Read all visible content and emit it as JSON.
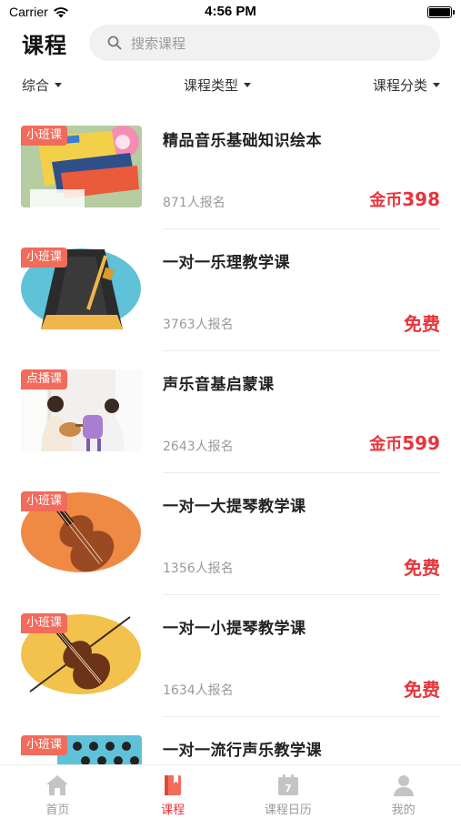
{
  "status_bar": {
    "carrier": "Carrier",
    "time": "4:56 PM"
  },
  "header": {
    "title": "课程",
    "search_placeholder": "搜索课程"
  },
  "filters": [
    {
      "label": "综合"
    },
    {
      "label": "课程类型"
    },
    {
      "label": "课程分类"
    }
  ],
  "courses": [
    {
      "tag": "小班课",
      "name": "精品音乐基础知识绘本",
      "count": "871人报名",
      "price_prefix": "金币",
      "price": "398",
      "image": "music-book-cover"
    },
    {
      "tag": "小班课",
      "name": "一对一乐理教学课",
      "count": "3763人报名",
      "price_prefix": "",
      "price": "免费",
      "image": "metronome"
    },
    {
      "tag": "点播课",
      "name": "声乐音基启蒙课",
      "count": "2643人报名",
      "price_prefix": "金币",
      "price": "599",
      "image": "ukulele-photo"
    },
    {
      "tag": "小班课",
      "name": "一对一大提琴教学课",
      "count": "1356人报名",
      "price_prefix": "",
      "price": "免费",
      "image": "cello"
    },
    {
      "tag": "小班课",
      "name": "一对一小提琴教学课",
      "count": "1634人报名",
      "price_prefix": "",
      "price": "免费",
      "image": "violin"
    },
    {
      "tag": "小班课",
      "name": "一对一流行声乐教学课",
      "count": "",
      "price_prefix": "",
      "price": "",
      "image": "polka-dot"
    }
  ],
  "tabbar": [
    {
      "label": "首页",
      "icon": "home-icon",
      "active": false
    },
    {
      "label": "课程",
      "icon": "book-icon",
      "active": true
    },
    {
      "label": "课程日历",
      "icon": "calendar-icon",
      "calendar_day": "7",
      "active": false
    },
    {
      "label": "我的",
      "icon": "person-icon",
      "active": false
    }
  ],
  "colors": {
    "accent": "#e8343a",
    "tag": "#f26b5b",
    "muted": "#999999"
  }
}
